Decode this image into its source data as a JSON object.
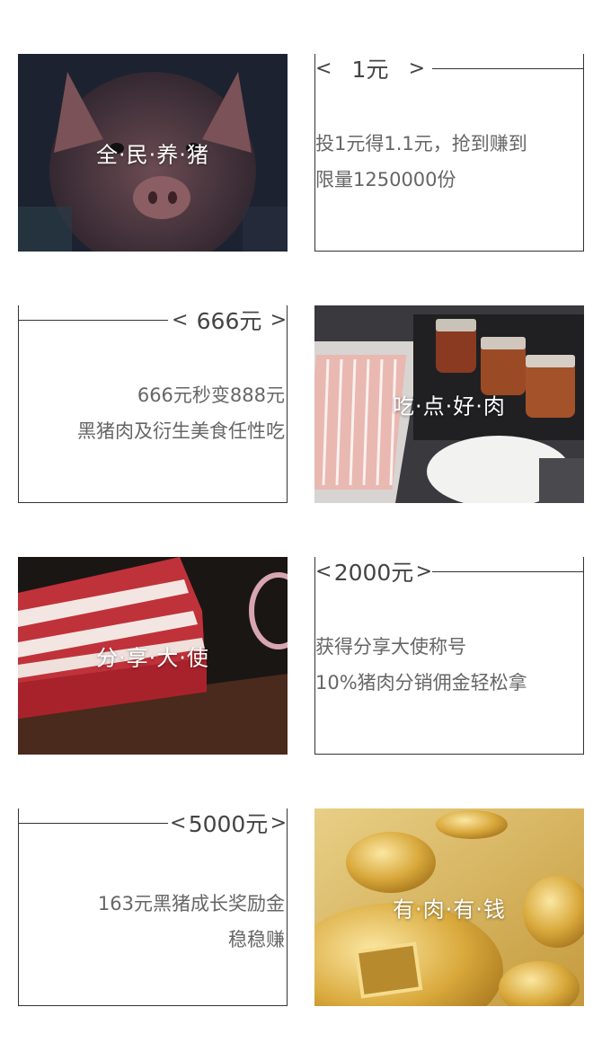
{
  "rows": [
    {
      "tile_title": "全·民·养·猪",
      "price": "1元",
      "desc": [
        "投1元得1.1元，抢到赚到",
        "限量1250000份"
      ]
    },
    {
      "tile_title": "吃·点·好·肉",
      "price": "666元",
      "desc": [
        "666元秒变888元",
        "黑猪肉及衍生美食任性吃"
      ]
    },
    {
      "tile_title": "分·享·大·使",
      "price": "2000元",
      "desc": [
        "获得分享大使称号",
        "10%猪肉分销佣金轻松拿"
      ]
    },
    {
      "tile_title": "有·肉·有·钱",
      "price": "5000元",
      "desc": [
        "163元黑猪成长奖励金",
        "稳稳赚"
      ]
    }
  ],
  "icons": {
    "prev": "chevron-left-icon",
    "next": "chevron-right-icon"
  },
  "colors": {
    "border": "#333333",
    "text": "#666666",
    "price": "#444444",
    "overlay_text": "#ffffff"
  }
}
